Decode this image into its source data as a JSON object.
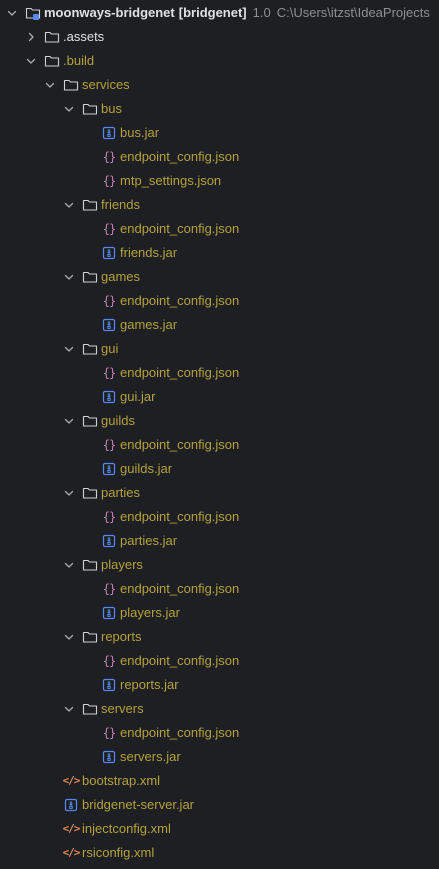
{
  "project": {
    "name": "moonways-bridgenet",
    "module": "[bridgenet]",
    "version": "1.0",
    "path": "C:\\Users\\itzst\\IdeaProjects"
  },
  "tree": [
    {
      "label": "moonways-bridgenet",
      "kind": "project",
      "depth": 0,
      "expanded": true,
      "style": "bold"
    },
    {
      "label": ".assets",
      "kind": "folder",
      "depth": 1,
      "expanded": false,
      "style": "normal"
    },
    {
      "label": ".build",
      "kind": "folder",
      "depth": 1,
      "expanded": true,
      "style": "excluded"
    },
    {
      "label": "services",
      "kind": "folder",
      "depth": 2,
      "expanded": true,
      "style": "excluded"
    },
    {
      "label": "bus",
      "kind": "folder",
      "depth": 3,
      "expanded": true,
      "style": "excluded"
    },
    {
      "label": "bus.jar",
      "kind": "jar",
      "depth": 4,
      "style": "excluded"
    },
    {
      "label": "endpoint_config.json",
      "kind": "json",
      "depth": 4,
      "style": "excluded"
    },
    {
      "label": "mtp_settings.json",
      "kind": "json",
      "depth": 4,
      "style": "excluded"
    },
    {
      "label": "friends",
      "kind": "folder",
      "depth": 3,
      "expanded": true,
      "style": "excluded"
    },
    {
      "label": "endpoint_config.json",
      "kind": "json",
      "depth": 4,
      "style": "excluded"
    },
    {
      "label": "friends.jar",
      "kind": "jar",
      "depth": 4,
      "style": "excluded"
    },
    {
      "label": "games",
      "kind": "folder",
      "depth": 3,
      "expanded": true,
      "style": "excluded"
    },
    {
      "label": "endpoint_config.json",
      "kind": "json",
      "depth": 4,
      "style": "excluded"
    },
    {
      "label": "games.jar",
      "kind": "jar",
      "depth": 4,
      "style": "excluded"
    },
    {
      "label": "gui",
      "kind": "folder",
      "depth": 3,
      "expanded": true,
      "style": "excluded"
    },
    {
      "label": "endpoint_config.json",
      "kind": "json",
      "depth": 4,
      "style": "excluded"
    },
    {
      "label": "gui.jar",
      "kind": "jar",
      "depth": 4,
      "style": "excluded"
    },
    {
      "label": "guilds",
      "kind": "folder",
      "depth": 3,
      "expanded": true,
      "style": "excluded"
    },
    {
      "label": "endpoint_config.json",
      "kind": "json",
      "depth": 4,
      "style": "excluded"
    },
    {
      "label": "guilds.jar",
      "kind": "jar",
      "depth": 4,
      "style": "excluded"
    },
    {
      "label": "parties",
      "kind": "folder",
      "depth": 3,
      "expanded": true,
      "style": "excluded"
    },
    {
      "label": "endpoint_config.json",
      "kind": "json",
      "depth": 4,
      "style": "excluded"
    },
    {
      "label": "parties.jar",
      "kind": "jar",
      "depth": 4,
      "style": "excluded"
    },
    {
      "label": "players",
      "kind": "folder",
      "depth": 3,
      "expanded": true,
      "style": "excluded"
    },
    {
      "label": "endpoint_config.json",
      "kind": "json",
      "depth": 4,
      "style": "excluded"
    },
    {
      "label": "players.jar",
      "kind": "jar",
      "depth": 4,
      "style": "excluded"
    },
    {
      "label": "reports",
      "kind": "folder",
      "depth": 3,
      "expanded": true,
      "style": "excluded"
    },
    {
      "label": "endpoint_config.json",
      "kind": "json",
      "depth": 4,
      "style": "excluded"
    },
    {
      "label": "reports.jar",
      "kind": "jar",
      "depth": 4,
      "style": "excluded"
    },
    {
      "label": "servers",
      "kind": "folder",
      "depth": 3,
      "expanded": true,
      "style": "excluded"
    },
    {
      "label": "endpoint_config.json",
      "kind": "json",
      "depth": 4,
      "style": "excluded"
    },
    {
      "label": "servers.jar",
      "kind": "jar",
      "depth": 4,
      "style": "excluded"
    },
    {
      "label": "bootstrap.xml",
      "kind": "xml",
      "depth": 2,
      "style": "excluded"
    },
    {
      "label": "bridgenet-server.jar",
      "kind": "jar",
      "depth": 2,
      "style": "excluded"
    },
    {
      "label": "injectconfig.xml",
      "kind": "xml",
      "depth": 2,
      "style": "excluded"
    },
    {
      "label": "rsiconfig.xml",
      "kind": "xml",
      "depth": 2,
      "style": "excluded"
    }
  ],
  "icons": {
    "folder": "folder-icon",
    "project": "project-module-icon",
    "jar": "jar-archive-icon",
    "json": "json-braces-icon",
    "xml": "xml-tag-icon"
  },
  "colors": {
    "background": "#1e1f22",
    "excluded_text": "#b5a13b",
    "normal_text": "#dfe1e5",
    "meta_text": "#8c8f94",
    "jar_icon": "#548af7",
    "json_icon": "#c77dbb",
    "xml_icon": "#e08855",
    "folder_icon": "#ced0d6"
  },
  "glyphs": {
    "json": "{}",
    "xml": "</>"
  }
}
